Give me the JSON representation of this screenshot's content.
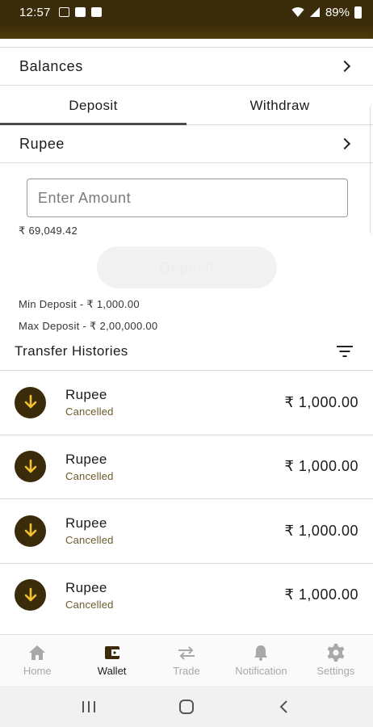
{
  "status_bar": {
    "time": "12:57",
    "battery": "89%"
  },
  "balances": {
    "label": "Balances"
  },
  "tabs": [
    {
      "label": "Deposit",
      "active": true
    },
    {
      "label": "Withdraw",
      "active": false
    }
  ],
  "currency": {
    "label": "Rupee"
  },
  "amount_input": {
    "placeholder": "Enter Amount",
    "value": ""
  },
  "available_balance": "₹ 69,049.42",
  "deposit_button": {
    "label": "Deposit"
  },
  "limits": {
    "min": "Min Deposit -  ₹ 1,000.00",
    "max": "Max Deposit -  ₹ 2,00,000.00"
  },
  "histories": {
    "title": "Transfer Histories",
    "items": [
      {
        "name": "Rupee",
        "status": "Cancelled",
        "amount": "₹ 1,000.00"
      },
      {
        "name": "Rupee",
        "status": "Cancelled",
        "amount": "₹ 1,000.00"
      },
      {
        "name": "Rupee",
        "status": "Cancelled",
        "amount": "₹ 1,000.00"
      },
      {
        "name": "Rupee",
        "status": "Cancelled",
        "amount": "₹ 1,000.00"
      }
    ]
  },
  "bottom_nav": [
    {
      "label": "Home",
      "icon": "home-icon",
      "active": false
    },
    {
      "label": "Wallet",
      "icon": "wallet-icon",
      "active": true
    },
    {
      "label": "Trade",
      "icon": "trade-icon",
      "active": false
    },
    {
      "label": "Notification",
      "icon": "bell-icon",
      "active": false
    },
    {
      "label": "Settings",
      "icon": "gear-icon",
      "active": false
    }
  ],
  "colors": {
    "brand": "#3a2c0a",
    "accent_yellow": "#f2c230",
    "status_text": "#6b5a2a",
    "inactive_nav": "#a8a8a8"
  }
}
